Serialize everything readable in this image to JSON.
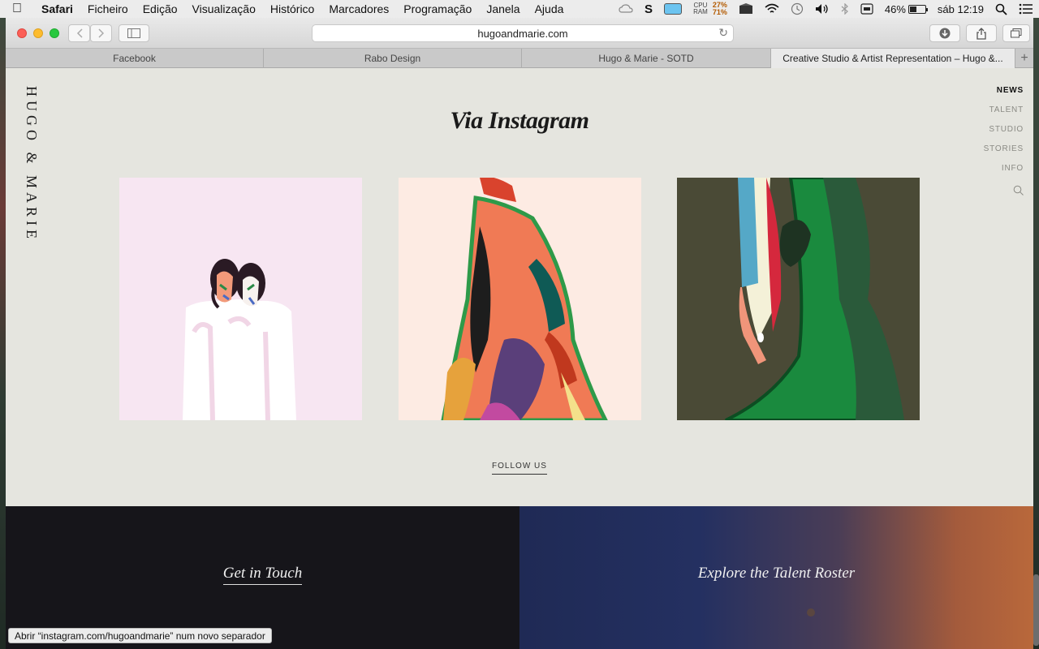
{
  "menubar": {
    "app": "Safari",
    "items": [
      "Ficheiro",
      "Edição",
      "Visualização",
      "Histórico",
      "Marcadores",
      "Programação",
      "Janela",
      "Ajuda"
    ],
    "cpu_label": "CPU",
    "ram_label": "RAM",
    "cpu_pct": "27%",
    "ram_pct": "71%",
    "battery_pct": "46%",
    "battery_level": 0.46,
    "clock": "sáb 12:19"
  },
  "browser": {
    "url": "hugoandmarie.com",
    "tabs": [
      {
        "title": "Facebook",
        "active": false
      },
      {
        "title": "Rabo Design",
        "active": false
      },
      {
        "title": "Hugo & Marie - SOTD",
        "active": false
      },
      {
        "title": "Creative Studio & Artist Representation – Hugo &...",
        "active": true
      }
    ],
    "status_text": "Abrir “instagram.com/hugoandmarie” num novo separador"
  },
  "page": {
    "logo": "HUGO & MARIE",
    "heading": "Via Instagram",
    "nav": [
      {
        "label": "NEWS",
        "active": true
      },
      {
        "label": "TALENT",
        "active": false
      },
      {
        "label": "STUDIO",
        "active": false
      },
      {
        "label": "STORIES",
        "active": false
      },
      {
        "label": "INFO",
        "active": false
      }
    ],
    "follow_label": "FOLLOW US",
    "footer": {
      "left": "Get in Touch",
      "right": "Explore the Talent Roster"
    }
  },
  "colors": {
    "page_bg": "#e5e5df",
    "footer_dark": "#16151a",
    "tile1_bg": "#f7e6f2",
    "tile2_bg": "#fdebe3",
    "tile3_bg": "#4a4a36"
  }
}
